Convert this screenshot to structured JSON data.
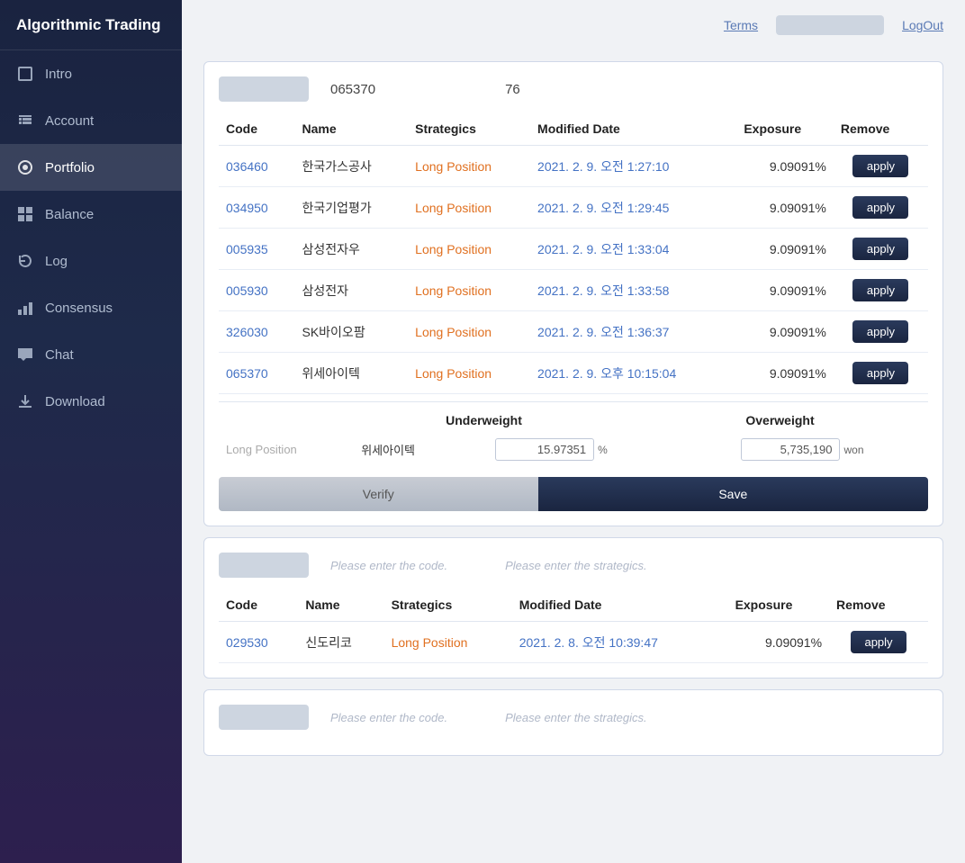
{
  "app": {
    "title": "Algorithmic Trading"
  },
  "topbar": {
    "terms": "Terms",
    "logout": "LogOut"
  },
  "sidebar": {
    "items": [
      {
        "id": "intro",
        "label": "Intro",
        "icon": "square"
      },
      {
        "id": "account",
        "label": "Account",
        "icon": "arrow-right-square"
      },
      {
        "id": "portfolio",
        "label": "Portfolio",
        "icon": "circle-dot",
        "active": true
      },
      {
        "id": "balance",
        "label": "Balance",
        "icon": "grid"
      },
      {
        "id": "log",
        "label": "Log",
        "icon": "refresh"
      },
      {
        "id": "consensus",
        "label": "Consensus",
        "icon": "bar-chart"
      },
      {
        "id": "chat",
        "label": "Chat",
        "icon": "chat"
      },
      {
        "id": "download",
        "label": "Download",
        "icon": "download"
      }
    ]
  },
  "portfolio1": {
    "code": "065370",
    "number": "76",
    "table": {
      "headers": [
        "Code",
        "Name",
        "Strategics",
        "Modified Date",
        "Exposure",
        "Remove"
      ],
      "rows": [
        {
          "code": "036460",
          "name": "한국가스공사",
          "strategics": "Long Position",
          "date": "2021. 2. 9. 오전 1:27:10",
          "exposure": "9.09091%",
          "apply": "apply"
        },
        {
          "code": "034950",
          "name": "한국기업평가",
          "strategics": "Long Position",
          "date": "2021. 2. 9. 오전 1:29:45",
          "exposure": "9.09091%",
          "apply": "apply"
        },
        {
          "code": "005935",
          "name": "삼성전자우",
          "strategics": "Long Position",
          "date": "2021. 2. 9. 오전 1:33:04",
          "exposure": "9.09091%",
          "apply": "apply"
        },
        {
          "code": "005930",
          "name": "삼성전자",
          "strategics": "Long Position",
          "date": "2021. 2. 9. 오전 1:33:58",
          "exposure": "9.09091%",
          "apply": "apply"
        },
        {
          "code": "326030",
          "name": "SK바이오팜",
          "strategics": "Long Position",
          "date": "2021. 2. 9. 오전 1:36:37",
          "exposure": "9.09091%",
          "apply": "apply"
        },
        {
          "code": "065370",
          "name": "위세아이텍",
          "strategics": "Long Position",
          "date": "2021. 2. 9. 오후 10:15:04",
          "exposure": "9.09091%",
          "apply": "apply"
        }
      ]
    },
    "position": {
      "label": "Long Position",
      "underweight": "Underweight",
      "overweight": "Overweight",
      "name": "위세아이텍",
      "underweight_value": "15.97351",
      "underweight_unit": "%",
      "overweight_value": "5,735,190",
      "overweight_unit": "won"
    },
    "verify_label": "Verify",
    "save_label": "Save"
  },
  "portfolio2": {
    "code_placeholder": "Please enter the code.",
    "strategics_placeholder": "Please enter the strategics.",
    "table": {
      "headers": [
        "Code",
        "Name",
        "Strategics",
        "Modified Date",
        "Exposure",
        "Remove"
      ],
      "rows": [
        {
          "code": "029530",
          "name": "신도리코",
          "strategics": "Long Position",
          "date": "2021. 2. 8. 오전 10:39:47",
          "exposure": "9.09091%",
          "apply": "apply"
        }
      ]
    }
  },
  "portfolio3": {
    "code_placeholder": "Please enter the code.",
    "strategics_placeholder": "Please enter the strategics."
  }
}
